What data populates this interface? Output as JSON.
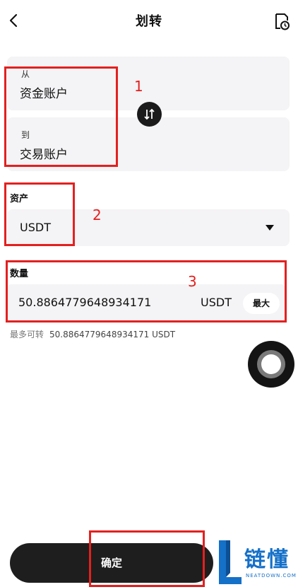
{
  "header": {
    "title": "划转",
    "back_icon": "chevron-left-icon",
    "history_icon": "document-clock-icon"
  },
  "from": {
    "label": "从",
    "value": "资金账户"
  },
  "to": {
    "label": "到",
    "value": "交易账户"
  },
  "swap_icon": "swap-arrows-icon",
  "asset": {
    "label": "资产",
    "value": "USDT",
    "dropdown_icon": "caret-down-icon"
  },
  "amount": {
    "label": "数量",
    "value": "50.8864779648934171",
    "unit": "USDT",
    "max_label": "最大"
  },
  "max_hint": {
    "label": "最多可转",
    "value": "50.8864779648934171 USDT"
  },
  "annotations": [
    "1",
    "2",
    "3"
  ],
  "confirm_label": "确定",
  "watermark": {
    "text": "链懂",
    "sub": "NEATDOWN.COM"
  },
  "colors": {
    "annotation": "#e3201f",
    "card_bg": "#f4f3f5",
    "button_bg": "#1e1e1e",
    "watermark": "#1570c8"
  }
}
